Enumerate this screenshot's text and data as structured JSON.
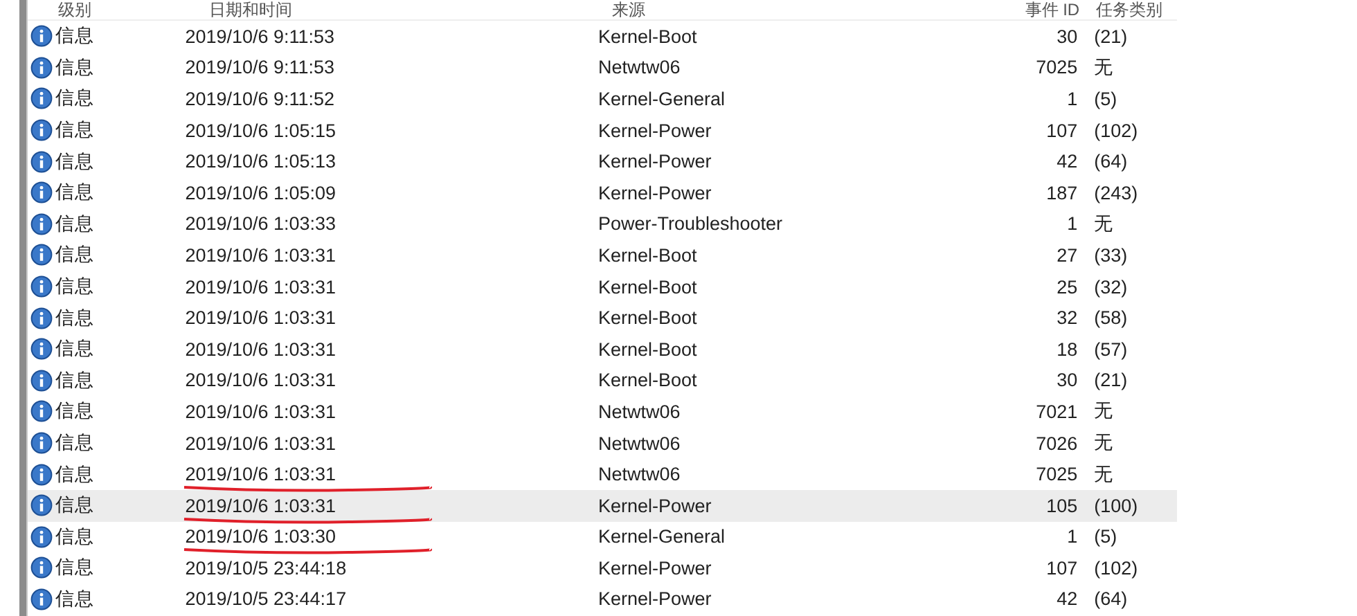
{
  "table": {
    "columns": [
      "级别",
      "日期和时间",
      "来源",
      "事件 ID",
      "任务类别"
    ],
    "rows": [
      {
        "level": "信息",
        "date": "2019/10/6 9:11:53",
        "source": "Kernel-Boot",
        "event_id": "30",
        "task": "(21)",
        "selected": false,
        "underlined": false
      },
      {
        "level": "信息",
        "date": "2019/10/6 9:11:53",
        "source": "Netwtw06",
        "event_id": "7025",
        "task": "无",
        "selected": false,
        "underlined": false
      },
      {
        "level": "信息",
        "date": "2019/10/6 9:11:52",
        "source": "Kernel-General",
        "event_id": "1",
        "task": "(5)",
        "selected": false,
        "underlined": false
      },
      {
        "level": "信息",
        "date": "2019/10/6 1:05:15",
        "source": "Kernel-Power",
        "event_id": "107",
        "task": "(102)",
        "selected": false,
        "underlined": false
      },
      {
        "level": "信息",
        "date": "2019/10/6 1:05:13",
        "source": "Kernel-Power",
        "event_id": "42",
        "task": "(64)",
        "selected": false,
        "underlined": false
      },
      {
        "level": "信息",
        "date": "2019/10/6 1:05:09",
        "source": "Kernel-Power",
        "event_id": "187",
        "task": "(243)",
        "selected": false,
        "underlined": false
      },
      {
        "level": "信息",
        "date": "2019/10/6 1:03:33",
        "source": "Power-Troubleshooter",
        "event_id": "1",
        "task": "无",
        "selected": false,
        "underlined": false
      },
      {
        "level": "信息",
        "date": "2019/10/6 1:03:31",
        "source": "Kernel-Boot",
        "event_id": "27",
        "task": "(33)",
        "selected": false,
        "underlined": false
      },
      {
        "level": "信息",
        "date": "2019/10/6 1:03:31",
        "source": "Kernel-Boot",
        "event_id": "25",
        "task": "(32)",
        "selected": false,
        "underlined": false
      },
      {
        "level": "信息",
        "date": "2019/10/6 1:03:31",
        "source": "Kernel-Boot",
        "event_id": "32",
        "task": "(58)",
        "selected": false,
        "underlined": false
      },
      {
        "level": "信息",
        "date": "2019/10/6 1:03:31",
        "source": "Kernel-Boot",
        "event_id": "18",
        "task": "(57)",
        "selected": false,
        "underlined": false
      },
      {
        "level": "信息",
        "date": "2019/10/6 1:03:31",
        "source": "Kernel-Boot",
        "event_id": "30",
        "task": "(21)",
        "selected": false,
        "underlined": false
      },
      {
        "level": "信息",
        "date": "2019/10/6 1:03:31",
        "source": "Netwtw06",
        "event_id": "7021",
        "task": "无",
        "selected": false,
        "underlined": false
      },
      {
        "level": "信息",
        "date": "2019/10/6 1:03:31",
        "source": "Netwtw06",
        "event_id": "7026",
        "task": "无",
        "selected": false,
        "underlined": false
      },
      {
        "level": "信息",
        "date": "2019/10/6 1:03:31",
        "source": "Netwtw06",
        "event_id": "7025",
        "task": "无",
        "selected": false,
        "underlined": true
      },
      {
        "level": "信息",
        "date": "2019/10/6 1:03:31",
        "source": "Kernel-Power",
        "event_id": "105",
        "task": "(100)",
        "selected": true,
        "underlined": true
      },
      {
        "level": "信息",
        "date": "2019/10/6 1:03:30",
        "source": "Kernel-General",
        "event_id": "1",
        "task": "(5)",
        "selected": false,
        "underlined": true
      },
      {
        "level": "信息",
        "date": "2019/10/5 23:44:18",
        "source": "Kernel-Power",
        "event_id": "107",
        "task": "(102)",
        "selected": false,
        "underlined": false
      },
      {
        "level": "信息",
        "date": "2019/10/5 23:44:17",
        "source": "Kernel-Power",
        "event_id": "42",
        "task": "(64)",
        "selected": false,
        "underlined": false
      }
    ]
  }
}
